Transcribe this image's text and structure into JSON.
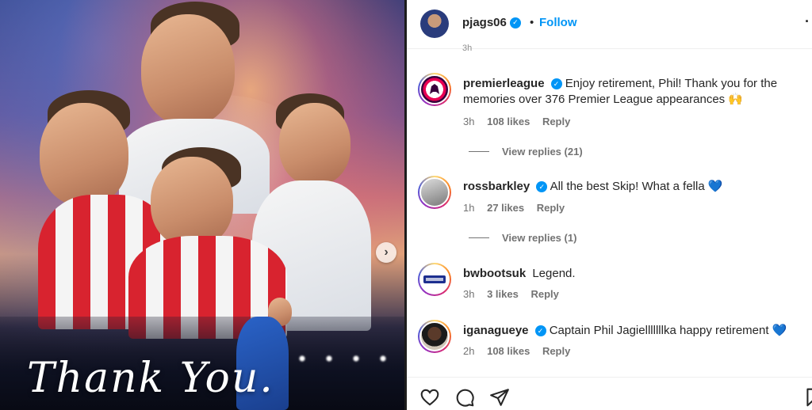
{
  "media": {
    "caption_art": "Thank You.",
    "next_glyph": "›"
  },
  "header": {
    "username": "pjags06",
    "verified_glyph": "✓",
    "separator": "•",
    "follow_label": "Follow",
    "more_glyph": "·"
  },
  "partial_top_text": "3h",
  "comments": [
    {
      "username": "premierleague",
      "text": "Enjoy retirement, Phil! Thank you for the memories over 376 Premier League appearances 🙌",
      "time": "3h",
      "likes": "108 likes",
      "reply": "Reply",
      "view_replies": "View replies (21)"
    },
    {
      "username": "rossbarkley",
      "text": "All the best Skip! What a fella 💙",
      "time": "1h",
      "likes": "27 likes",
      "reply": "Reply",
      "view_replies": "View replies (1)"
    },
    {
      "username": "bwbootsuk",
      "text": "Legend.",
      "time": "3h",
      "likes": "3 likes",
      "reply": "Reply"
    },
    {
      "username": "iganagueye",
      "text": "Captain Phil Jagielllllllka happy retirement 💙",
      "time": "2h",
      "likes": "108 likes",
      "reply": "Reply"
    }
  ],
  "colors": {
    "accent": "#0095f6",
    "text": "#262626",
    "muted": "#737373"
  }
}
